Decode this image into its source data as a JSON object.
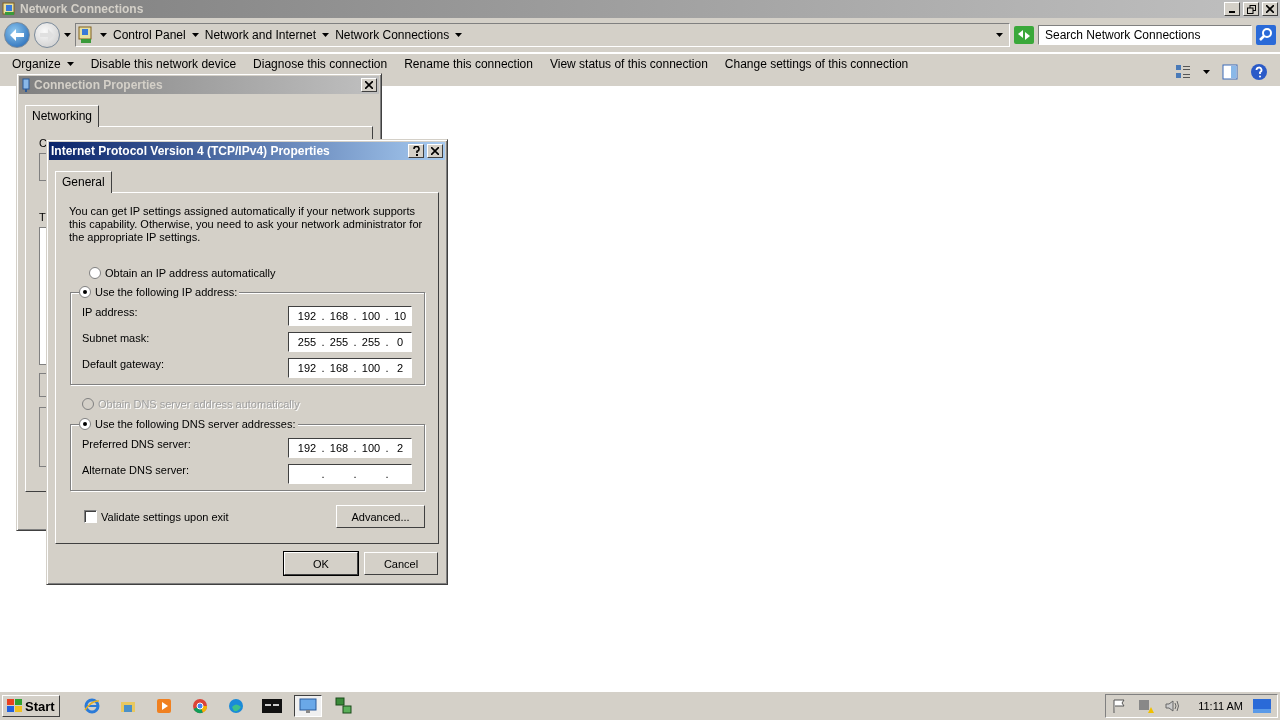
{
  "window": {
    "title": "Network Connections"
  },
  "address_bar": {
    "breadcrumbs": [
      "Control Panel",
      "Network and Internet",
      "Network Connections"
    ]
  },
  "search": {
    "placeholder": "Search Network Connections"
  },
  "toolbar": {
    "items": [
      {
        "label": "Organize",
        "has_menu": true
      },
      {
        "label": "Disable this network device",
        "has_menu": false
      },
      {
        "label": "Diagnose this connection",
        "has_menu": false
      },
      {
        "label": "Rename this connection",
        "has_menu": false
      },
      {
        "label": "View status of this connection",
        "has_menu": false
      },
      {
        "label": "Change settings of this connection",
        "has_menu": false
      }
    ]
  },
  "connection_dialog": {
    "title": "Connection Properties",
    "tabs": [
      {
        "label": "Networking",
        "selected": true
      }
    ],
    "fragments": [
      "C",
      "T"
    ]
  },
  "ipv4_dialog": {
    "title": "Internet Protocol Version 4 (TCP/IPv4) Properties",
    "tabs": [
      {
        "label": "General",
        "selected": true
      }
    ],
    "intro": "You can get IP settings assigned automatically if your network supports this capability. Otherwise, you need to ask your network administrator for the appropriate IP settings.",
    "separator": ".",
    "ip_options": [
      {
        "label": "Obtain an IP address automatically",
        "selected": false,
        "disabled": false
      },
      {
        "label": "Use the following IP address:",
        "selected": true,
        "disabled": false
      }
    ],
    "ip_fields": [
      {
        "label": "IP address:",
        "octets": [
          "192",
          "168",
          "100",
          "10"
        ]
      },
      {
        "label": "Subnet mask:",
        "octets": [
          "255",
          "255",
          "255",
          "0"
        ]
      },
      {
        "label": "Default gateway:",
        "octets": [
          "192",
          "168",
          "100",
          "2"
        ]
      }
    ],
    "dns_options": [
      {
        "label": "Obtain DNS server address automatically",
        "selected": false,
        "disabled": true
      },
      {
        "label": "Use the following DNS server addresses:",
        "selected": true,
        "disabled": false
      }
    ],
    "dns_fields": [
      {
        "label": "Preferred DNS server:",
        "octets": [
          "192",
          "168",
          "100",
          "2"
        ]
      },
      {
        "label": "Alternate DNS server:"
      }
    ],
    "validate": {
      "label": "Validate settings upon exit",
      "checked": false
    },
    "advanced": "Advanced...",
    "buttons": [
      {
        "label": "OK",
        "default": true
      },
      {
        "label": "Cancel",
        "default": false
      }
    ]
  },
  "taskbar": {
    "start": "Start",
    "apps": [
      {
        "kind": "ie",
        "active": false
      },
      {
        "kind": "folder",
        "active": false
      },
      {
        "kind": "media",
        "active": false
      },
      {
        "kind": "chrome",
        "active": false
      },
      {
        "kind": "edge",
        "active": false
      },
      {
        "kind": "cmd",
        "active": false
      },
      {
        "kind": "monitor",
        "active": true
      },
      {
        "kind": "network",
        "active": false
      }
    ],
    "clock": "11:11 AM"
  }
}
